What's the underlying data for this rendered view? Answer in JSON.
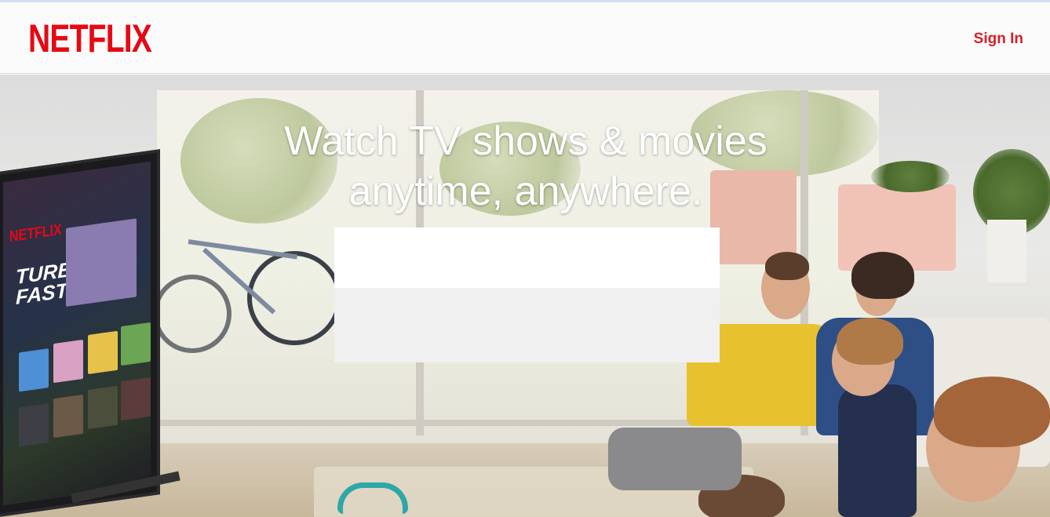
{
  "header": {
    "logo_text": "NETFLIX",
    "sign_in_label": "Sign In"
  },
  "hero": {
    "headline_line1": "Watch TV shows & movies",
    "headline_line2": "anytime, anywhere.",
    "tv_logo": "NETFLIX",
    "tv_feature_title": "TURBO FAST"
  },
  "colors": {
    "brand_red": "#e50914",
    "sign_in_red": "#d81f26",
    "header_bg": "#fafafa"
  }
}
